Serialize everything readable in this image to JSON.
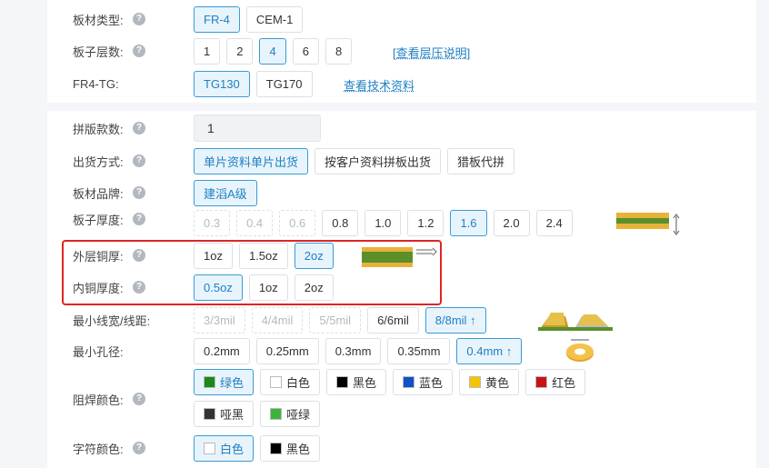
{
  "board_type": {
    "label": "板材类型:",
    "options": [
      "FR-4",
      "CEM-1"
    ],
    "selected": 0
  },
  "layers": {
    "label": "板子层数:",
    "options": [
      "1",
      "2",
      "4",
      "6",
      "8"
    ],
    "selected": 2,
    "link": "[查看层压说明]"
  },
  "tg": {
    "label": "FR4-TG:",
    "options": [
      "TG130",
      "TG170"
    ],
    "selected": 0,
    "link": "查看技术资料"
  },
  "panel_count": {
    "label": "拼版款数:",
    "value": "1"
  },
  "shipping": {
    "label": "出货方式:",
    "options": [
      "单片资料单片出货",
      "按客户资料拼板出货",
      "猎板代拼"
    ],
    "selected": 0
  },
  "brand": {
    "label": "板材品牌:",
    "options": [
      "建滔A级"
    ],
    "selected": 0
  },
  "thickness": {
    "label": "板子厚度:",
    "options": [
      "0.3",
      "0.4",
      "0.6",
      "0.8",
      "1.0",
      "1.2",
      "1.6",
      "2.0",
      "2.4"
    ],
    "selected": 6,
    "disabled": [
      0,
      1,
      2
    ]
  },
  "outer_copper": {
    "label": "外层铜厚:",
    "options": [
      "1oz",
      "1.5oz",
      "2oz"
    ],
    "selected": 2
  },
  "inner_copper": {
    "label": "内铜厚度:",
    "options": [
      "0.5oz",
      "1oz",
      "2oz"
    ],
    "selected": 0
  },
  "trace": {
    "label": "最小线宽/线距:",
    "options": [
      "3/3mil",
      "4/4mil",
      "5/5mil",
      "6/6mil",
      "8/8mil ↑"
    ],
    "selected": 4,
    "disabled": [
      0,
      1,
      2
    ]
  },
  "hole": {
    "label": "最小孔径:",
    "options": [
      "0.2mm",
      "0.25mm",
      "0.3mm",
      "0.35mm",
      "0.4mm ↑"
    ],
    "selected": 4
  },
  "solder_mask": {
    "label": "阻焊颜色:",
    "options": [
      {
        "name": "绿色",
        "color": "#1a8a1a"
      },
      {
        "name": "白色",
        "color": "#ffffff"
      },
      {
        "name": "黑色",
        "color": "#000000"
      },
      {
        "name": "蓝色",
        "color": "#1450c8"
      },
      {
        "name": "黄色",
        "color": "#f5c400"
      },
      {
        "name": "红色",
        "color": "#c81414"
      },
      {
        "name": "哑黑",
        "color": "#333333"
      },
      {
        "name": "哑绿",
        "color": "#3cb43c"
      }
    ],
    "selected": 0
  },
  "silkscreen": {
    "label": "字符颜色:",
    "options": [
      {
        "name": "白色",
        "color": "#ffffff"
      },
      {
        "name": "黑色",
        "color": "#000000"
      }
    ],
    "selected": 0
  },
  "help_icon": "?",
  "colors": {
    "accent": "#1f7fc2",
    "selected_bg": "#e8f4fc",
    "highlight_box": "#e02424"
  }
}
